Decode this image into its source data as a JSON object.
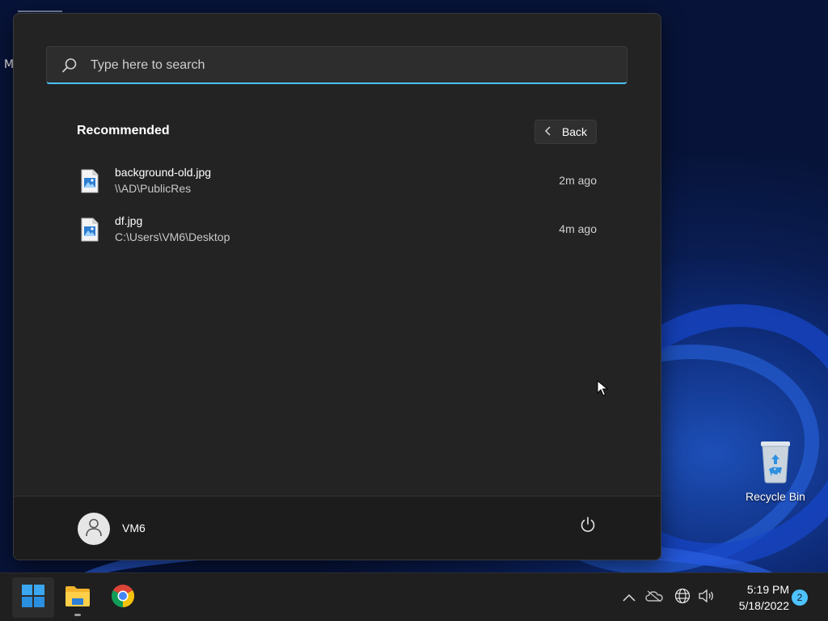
{
  "desktop": {
    "edge_letter": "M",
    "recycle_bin_label": "Recycle Bin"
  },
  "start_menu": {
    "search_placeholder": "Type here to search",
    "recommended_title": "Recommended",
    "back_label": "Back",
    "items": [
      {
        "name": "background-old.jpg",
        "path": "\\\\AD\\PublicRes",
        "time": "2m ago",
        "icon": "image-file-icon"
      },
      {
        "name": "df.jpg",
        "path": "C:\\Users\\VM6\\Desktop",
        "time": "4m ago",
        "icon": "image-file-icon"
      }
    ],
    "user_name": "VM6"
  },
  "taskbar": {
    "apps": [
      "start-icon",
      "file-explorer-icon",
      "chrome-icon"
    ],
    "tray_icons": [
      "chevron-up-icon",
      "onedrive-icon",
      "network-icon",
      "volume-icon"
    ],
    "time": "5:19 PM",
    "date": "5/18/2022",
    "notification_count": "2"
  },
  "colors": {
    "accent": "#4cc2ff",
    "menu_bg": "#232323",
    "taskbar_bg": "#1f1f1f"
  }
}
